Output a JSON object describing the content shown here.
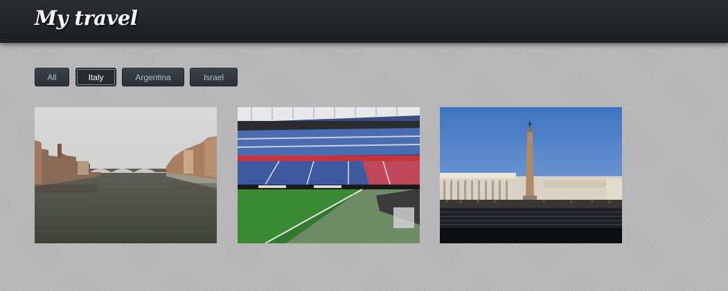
{
  "header": {
    "title": "My travel"
  },
  "filters": [
    {
      "label": "All",
      "active": false
    },
    {
      "label": "Italy",
      "active": true
    },
    {
      "label": "Argentina",
      "active": false
    },
    {
      "label": "Israel",
      "active": false
    }
  ],
  "gallery": [
    {
      "subject": "river-bridge-city"
    },
    {
      "subject": "football-stadium"
    },
    {
      "subject": "square-obelisk-colonnade"
    }
  ]
}
